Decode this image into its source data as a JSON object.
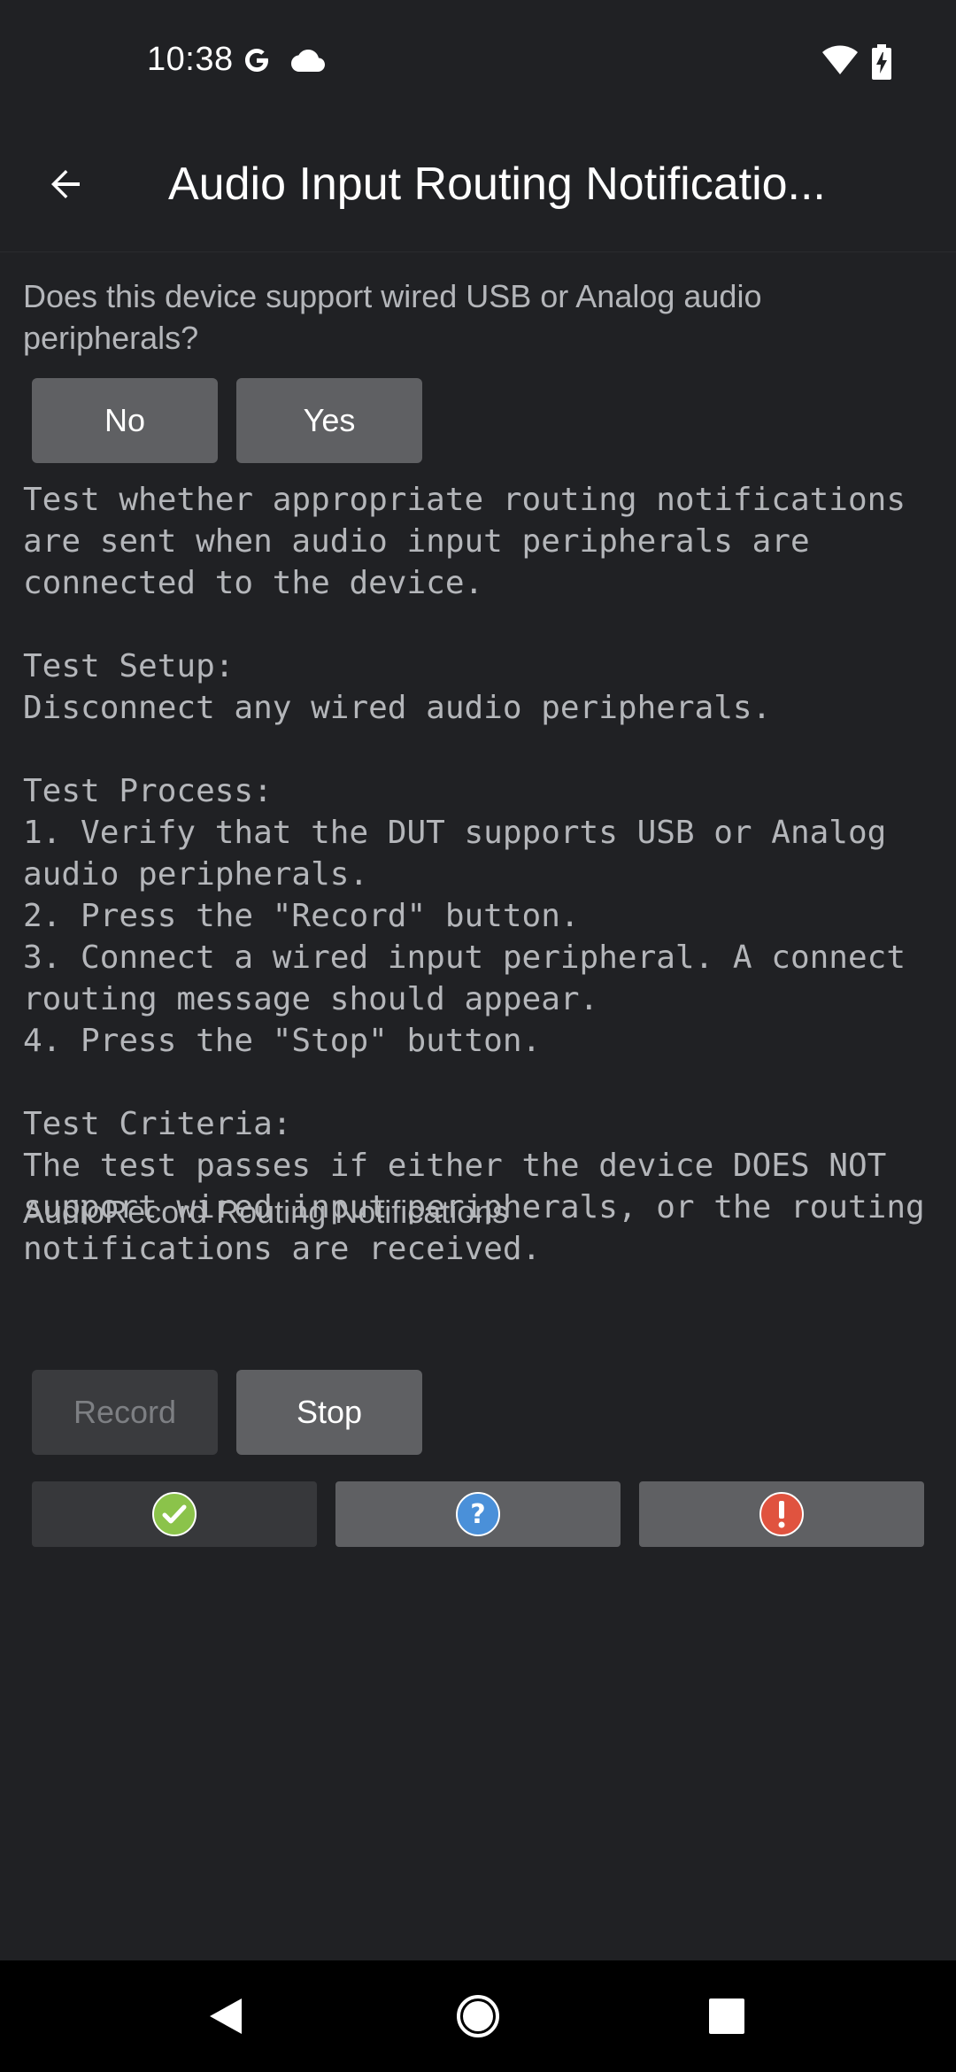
{
  "status_bar": {
    "time": "10:38",
    "icons": [
      "google-g-icon",
      "cloud-icon",
      "wifi-icon",
      "battery-charging-icon"
    ]
  },
  "app_bar": {
    "back_icon": "arrow-back-icon",
    "title": "Audio Input Routing Notificatio..."
  },
  "support_question": {
    "text": "Does this device support wired USB or Analog audio peripherals?",
    "no_label": "No",
    "yes_label": "Yes"
  },
  "instructions": "Test whether appropriate routing notifications are sent when audio input peripherals are connected to the device.\n\nTest Setup:\nDisconnect any wired audio peripherals.\n\nTest Process:\n1. Verify that the DUT supports USB or Analog audio peripherals.\n2. Press the \"Record\" button.\n3. Connect a wired input peripheral. A connect routing message should appear.\n4. Press the \"Stop\" button.\n\nTest Criteria:\nThe test passes if either the device DOES NOT support wired input peripherals, or the routing notifications are received.",
  "routing_label": "AudioRecord Routing Notifications",
  "controls": {
    "record_label": "Record",
    "record_enabled": false,
    "stop_label": "Stop",
    "stop_enabled": true
  },
  "result_buttons": [
    {
      "name": "pass",
      "icon": "check-circle-icon",
      "color": "#8bc34a"
    },
    {
      "name": "info",
      "icon": "question-circle-icon",
      "color": "#4a90d9"
    },
    {
      "name": "fail",
      "icon": "exclamation-circle-icon",
      "color": "#e0533f"
    }
  ],
  "nav_bar": {
    "icons": [
      "nav-back-icon",
      "nav-home-icon",
      "nav-recents-icon"
    ]
  }
}
